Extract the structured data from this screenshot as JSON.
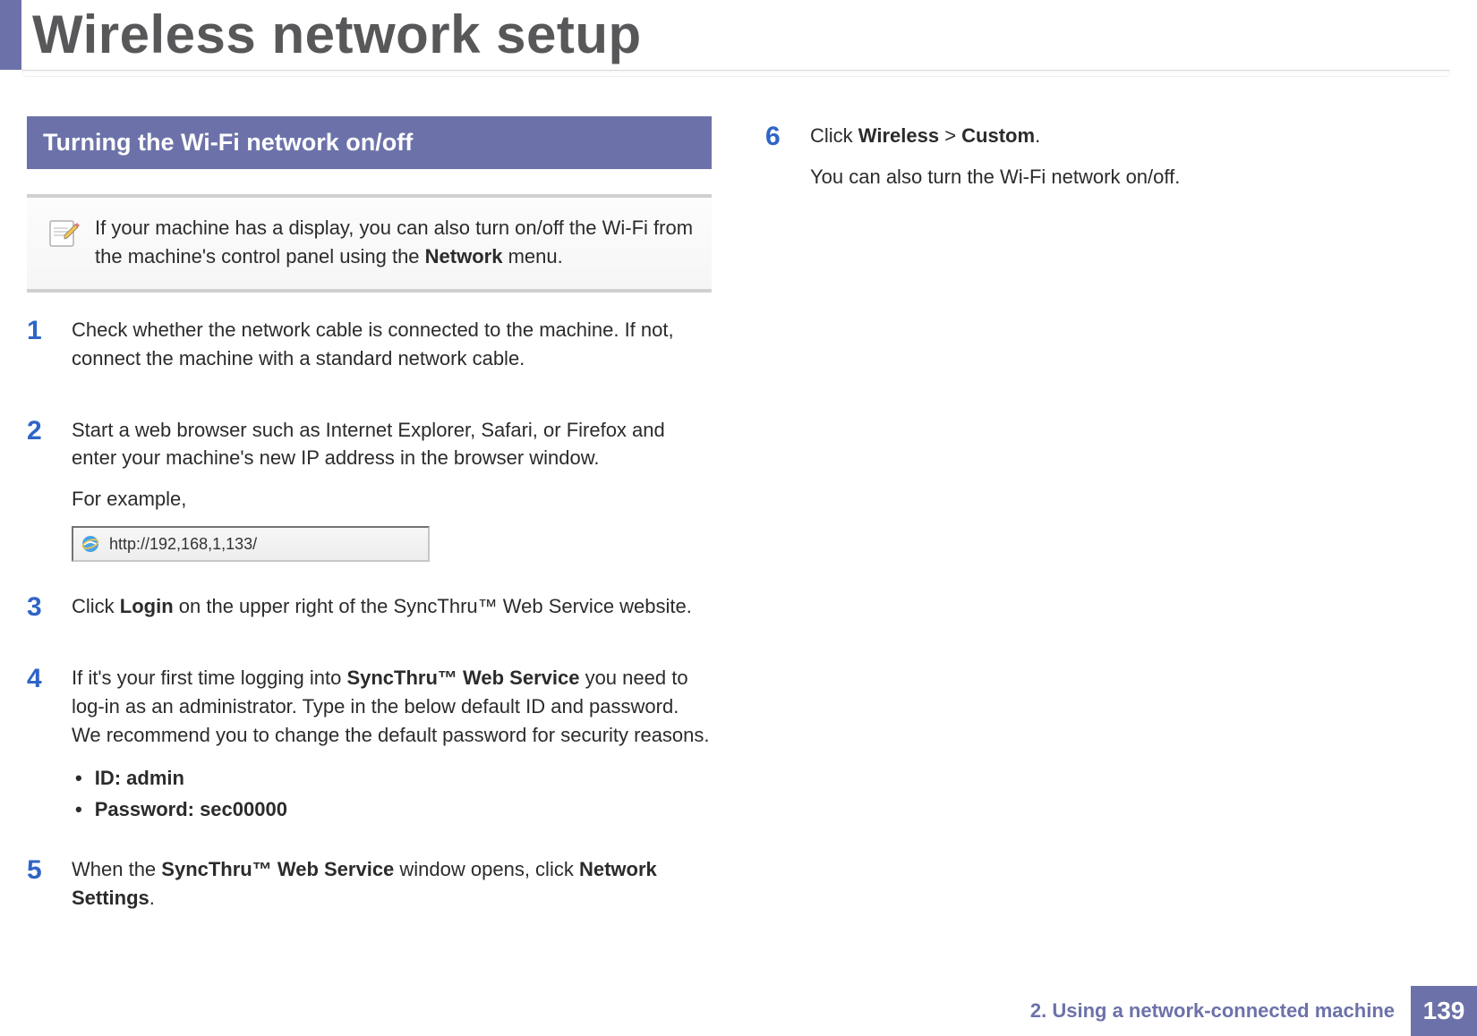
{
  "header": {
    "title": "Wireless network setup"
  },
  "section": {
    "heading": "Turning the Wi-Fi network on/off"
  },
  "note": {
    "text_prefix": "If your machine has a display, you can also turn on/off the Wi-Fi from the machine's control panel using the ",
    "bold": "Network",
    "text_suffix": " menu."
  },
  "steps_left": [
    {
      "num": "1",
      "parts": [
        {
          "type": "p",
          "segments": [
            {
              "t": "Check whether the network cable is connected to the machine. If not, connect the machine with a standard network cable."
            }
          ]
        }
      ]
    },
    {
      "num": "2",
      "parts": [
        {
          "type": "p",
          "segments": [
            {
              "t": "Start a web browser such as Internet Explorer, Safari, or Firefox and enter your machine's new IP address in the browser window."
            }
          ]
        },
        {
          "type": "p",
          "segments": [
            {
              "t": "For example,"
            }
          ]
        },
        {
          "type": "urlbox",
          "url": "http://192,168,1,133/"
        }
      ]
    },
    {
      "num": "3",
      "parts": [
        {
          "type": "p",
          "segments": [
            {
              "t": "Click "
            },
            {
              "b": "Login"
            },
            {
              "t": " on the upper right of the SyncThru™ Web Service website."
            }
          ]
        }
      ]
    },
    {
      "num": "4",
      "parts": [
        {
          "type": "p",
          "segments": [
            {
              "t": "If it's your first time logging into "
            },
            {
              "b": "SyncThru™ Web Service"
            },
            {
              "t": " you need to log-in as an administrator. Type in the below default ID and password. We recommend you to change the default password for security reasons."
            }
          ]
        },
        {
          "type": "bullets",
          "items": [
            "ID: admin",
            "Password: sec00000"
          ]
        }
      ]
    },
    {
      "num": "5",
      "parts": [
        {
          "type": "p",
          "segments": [
            {
              "t": "When the "
            },
            {
              "b": "SyncThru™ Web Service"
            },
            {
              "t": " window opens, click "
            },
            {
              "b": "Network Settings"
            },
            {
              "t": "."
            }
          ]
        }
      ]
    }
  ],
  "steps_right": [
    {
      "num": "6",
      "parts": [
        {
          "type": "p",
          "segments": [
            {
              "t": "Click "
            },
            {
              "b": "Wireless"
            },
            {
              "t": " > "
            },
            {
              "b": "Custom"
            },
            {
              "t": "."
            }
          ]
        },
        {
          "type": "p",
          "segments": [
            {
              "t": "You can also turn the Wi-Fi network on/off."
            }
          ]
        }
      ]
    }
  ],
  "footer": {
    "chapter": "2.  Using a network-connected machine",
    "page": "139"
  }
}
